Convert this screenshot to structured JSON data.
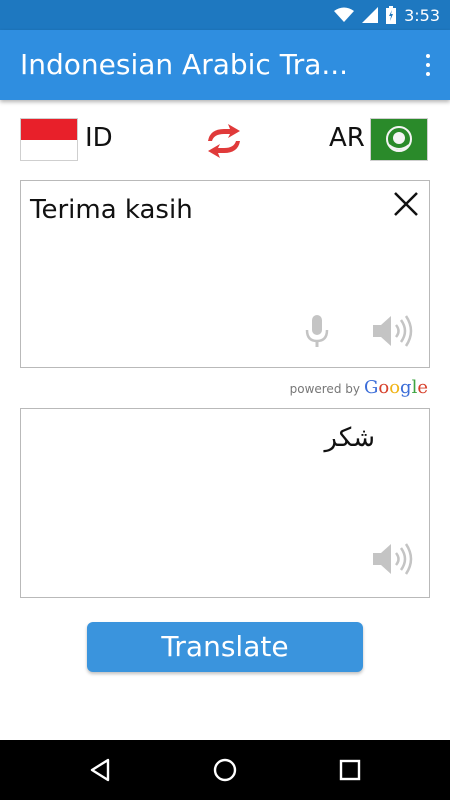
{
  "status_bar": {
    "time": "3:53",
    "icons": [
      "wifi-icon",
      "signal-icon",
      "battery-icon"
    ]
  },
  "app_bar": {
    "title": "Indonesian Arabic Tra...",
    "menu_icon": "overflow-menu-icon"
  },
  "languages": {
    "source_code": "ID",
    "target_code": "AR",
    "source_flag": "indonesia-flag",
    "target_flag": "arab-league-flag",
    "swap_icon": "swap-arrows-icon"
  },
  "source_box": {
    "text": "Terima kasih",
    "icons": [
      "close-icon",
      "microphone-icon",
      "speaker-icon"
    ]
  },
  "attribution": {
    "powered_by": "powered by",
    "brand": "Google"
  },
  "target_box": {
    "text": "شكر",
    "icons": [
      "speaker-icon"
    ]
  },
  "translate_button": {
    "label": "Translate"
  },
  "nav_bar": {
    "icons": [
      "back-icon",
      "home-icon",
      "recents-icon"
    ]
  },
  "colors": {
    "status_bar": "#1e78c0",
    "app_bar": "#2f8ee0",
    "accent_swap": "#e03a3a",
    "button": "#3a94dd"
  }
}
